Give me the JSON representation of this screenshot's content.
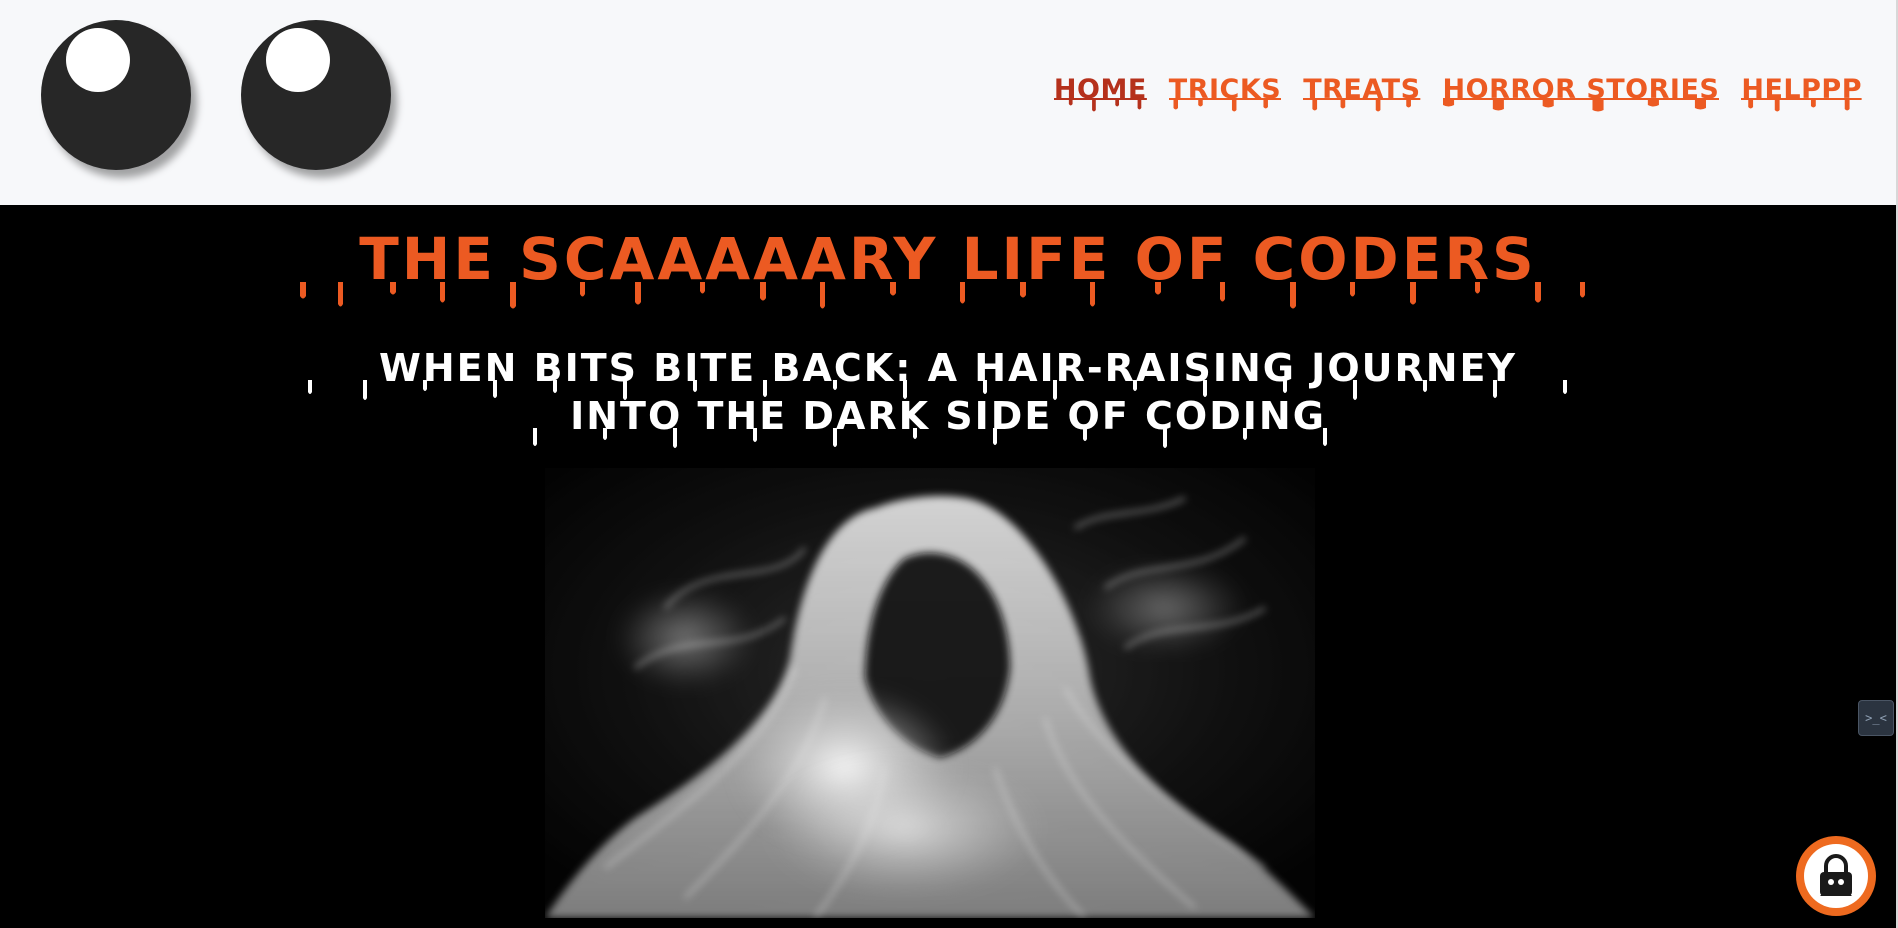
{
  "nav": {
    "items": [
      {
        "label": "HOME",
        "active": true
      },
      {
        "label": "TRICKS",
        "active": false
      },
      {
        "label": "TREATS",
        "active": false
      },
      {
        "label": "HORROR STORIES",
        "active": false
      },
      {
        "label": "HELPPP",
        "active": false
      }
    ]
  },
  "hero": {
    "title": "THE SCAAAAARY LIFE OF CODERS",
    "subtitle_line1": "WHEN BITS BITE BACK: A HAIR-RAISING JOURNEY",
    "subtitle_line2": "INTO THE DARK SIDE OF CODING"
  },
  "side_widget": {
    "label": ">_<"
  },
  "colors": {
    "accent": "#ec5a22",
    "accent_active": "#b5311c",
    "header_bg": "#f7f8fa",
    "page_bg": "#000000",
    "eye": "#272727"
  }
}
